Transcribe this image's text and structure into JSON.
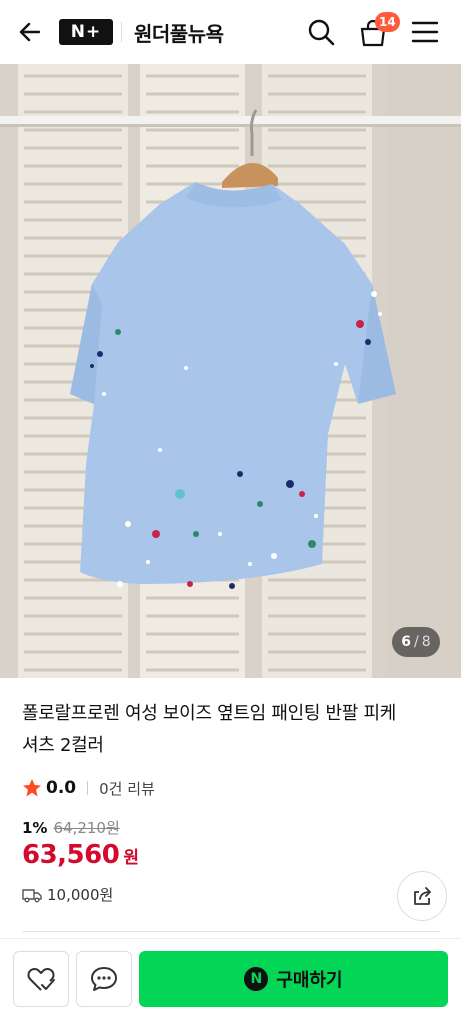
{
  "header": {
    "logo_text": "N+",
    "store_name": "원더풀뉴욕",
    "cart_count": "14",
    "icons": [
      "back-arrow-icon",
      "search-icon",
      "cart-icon",
      "menu-icon"
    ]
  },
  "gallery": {
    "current": "6",
    "separator": "/",
    "total": "8"
  },
  "product": {
    "title_line1": "폴로랄프로렌 여성 보이즈 옆트임 패인팅 반팔 피케",
    "title_line2": "셔츠 2컬러",
    "rating": "0.0",
    "review_count": "0건 리뷰",
    "discount_rate": "1%",
    "original_price": "64,210원",
    "sale_price": "63,560",
    "currency": "원",
    "shipping_fee": "10,000원"
  },
  "actions": {
    "buy_label": "구매하기",
    "npay_mark": "N"
  },
  "colors": {
    "accent_green": "#03d557",
    "price_red": "#d30a2e",
    "badge_orange": "#ff5a3c",
    "star_orange": "#ff4b1f"
  }
}
